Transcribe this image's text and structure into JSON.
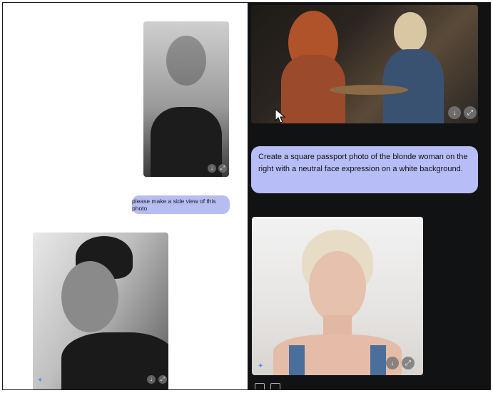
{
  "left_panel": {
    "top_image": {
      "actions": [
        "download-icon",
        "expand-icon"
      ]
    },
    "prompt_bubble": {
      "text": "please make a side view of this photo"
    },
    "bottom_image": {
      "actions": [
        "download-icon",
        "expand-icon"
      ],
      "badge": "sparkle-icon"
    }
  },
  "right_panel": {
    "top_image": {
      "actions": [
        "download-icon",
        "expand-icon"
      ]
    },
    "prompt_bubble": {
      "text": "Create a square passport photo of the blonde woman on the right with a neutral face expression on a white background."
    },
    "bottom_image": {
      "actions": [
        "download-icon",
        "expand-icon"
      ],
      "badge": "sparkle-icon"
    },
    "feedback": [
      "thumbs-up-icon",
      "thumbs-down-icon"
    ]
  },
  "colors": {
    "bubble": "#b7bef7",
    "dark_bg": "#111214",
    "light_bg": "#ffffff"
  }
}
